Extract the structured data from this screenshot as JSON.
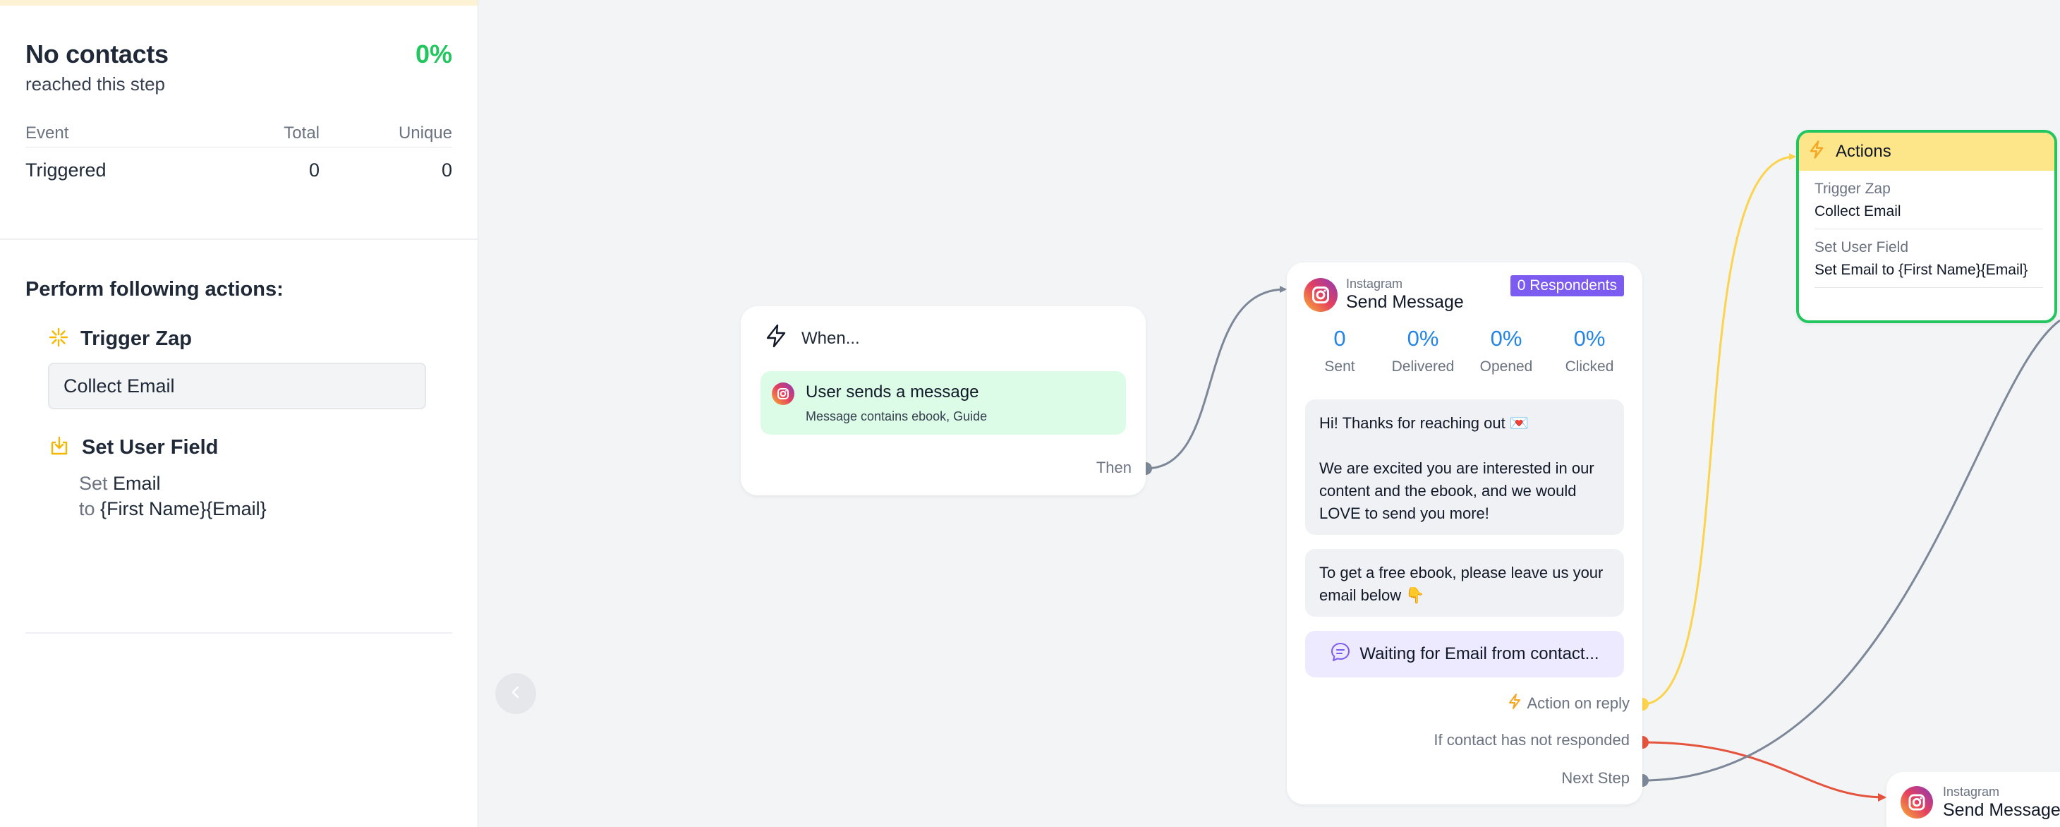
{
  "sidebar": {
    "stats": {
      "title": "No contacts",
      "subtitle": "reached this step",
      "percent": "0%",
      "columns": {
        "event": "Event",
        "total": "Total",
        "unique": "Unique"
      },
      "row": {
        "event": "Triggered",
        "total": "0",
        "unique": "0"
      }
    },
    "actions": {
      "heading": "Perform following actions:",
      "trigger_zap": {
        "title": "Trigger Zap",
        "value": "Collect Email"
      },
      "set_user_field": {
        "title": "Set User Field",
        "set_label": "Set",
        "field": "Email",
        "to_label": "to",
        "value": "{First Name}{Email}"
      }
    },
    "collapse_icon": "chevron-left-icon"
  },
  "when_node": {
    "title": "When...",
    "icon": "lightning-icon",
    "trigger": {
      "title": "User sends a message",
      "subtitle": "Message contains ebook, Guide",
      "icon": "instagram-icon"
    },
    "then_label": "Then"
  },
  "message_node": {
    "platform": "Instagram",
    "title": "Send Message",
    "respondents": "0 Respondents",
    "metrics": [
      {
        "value": "0",
        "label": "Sent"
      },
      {
        "value": "0%",
        "label": "Delivered"
      },
      {
        "value": "0%",
        "label": "Opened"
      },
      {
        "value": "0%",
        "label": "Clicked"
      }
    ],
    "bubble1": {
      "line1": "Hi! Thanks for reaching out 💌",
      "line2": "We are excited you are interested in our content and the ebook, and we would LOVE to send you more!"
    },
    "bubble2": "To get a free ebook, please leave us your email below 👇",
    "waiting": "Waiting for Email from contact...",
    "outputs": {
      "reply": "Action on reply",
      "no_response": "If contact has not responded",
      "next": "Next Step"
    }
  },
  "actions_node": {
    "title": "Actions",
    "items": [
      {
        "label": "Trigger Zap",
        "value": "Collect Email"
      },
      {
        "label": "Set User Field",
        "value": "Set Email to {First Name}{Email}"
      }
    ]
  },
  "message_node_2": {
    "platform": "Instagram",
    "title": "Send Message"
  },
  "colors": {
    "accent_green": "#22c55e",
    "metric_blue": "#2385e6",
    "respondents_purple": "#7c5cf0",
    "reply_edge": "#fcd34d",
    "noresp_edge": "#e5533d",
    "next_edge": "#7c8798"
  }
}
